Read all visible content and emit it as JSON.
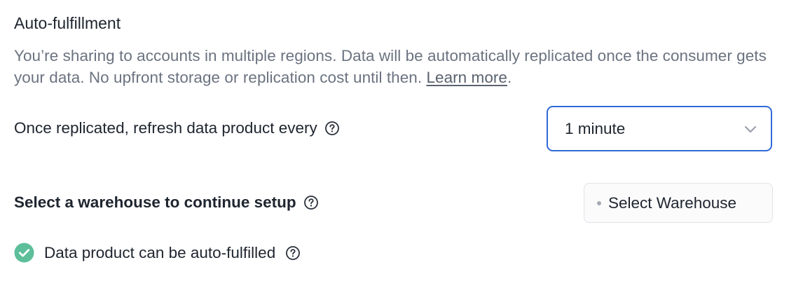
{
  "section": {
    "title": "Auto-fulfillment"
  },
  "description": {
    "text": "You’re sharing to accounts in multiple regions. Data will be automatically replicated once the consumer gets your data. No upfront storage or replication cost until then. ",
    "link_label": "Learn more",
    "trailing": "."
  },
  "refresh": {
    "label": "Once replicated, refresh data product every",
    "help_icon": "question-circle-icon",
    "selected_value": "1 minute",
    "chevron_icon": "chevron-down-icon"
  },
  "warehouse": {
    "label": "Select a warehouse to continue setup",
    "help_icon": "question-circle-icon",
    "button_label": "Select Warehouse"
  },
  "status": {
    "label": "Data product can be auto-fulfilled",
    "icon": "check-circle-icon",
    "icon_color": "#5cbf9a",
    "help_icon": "question-circle-icon"
  },
  "colors": {
    "accent_border": "#2f6ad6",
    "muted_text": "#6b7380",
    "primary_text": "#1e252f"
  }
}
